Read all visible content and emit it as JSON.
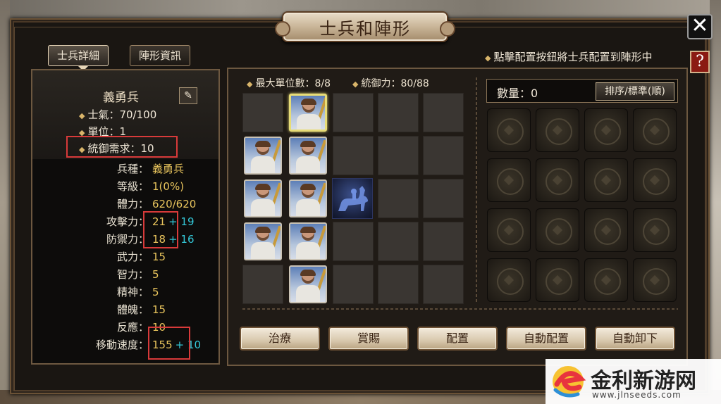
{
  "window": {
    "title": "士兵和陣形",
    "close_label": "✕",
    "help_label": "?"
  },
  "tabs": [
    {
      "label": "士兵詳細",
      "active": true
    },
    {
      "label": "陣形資訊",
      "active": false
    }
  ],
  "instruction": "點擊配置按鈕將士兵配置到陣形中",
  "unit": {
    "name": "義勇兵",
    "morale": "士氣：70/100",
    "units": "單位：1",
    "command_req": "統御需求：10"
  },
  "stats": [
    {
      "label": "兵種：",
      "value": "義勇兵",
      "bonus": ""
    },
    {
      "label": "等級：",
      "value": "1(0%)",
      "bonus": ""
    },
    {
      "label": "體力：",
      "value": "620/620",
      "bonus": ""
    },
    {
      "label": "攻擊力：",
      "value": "21",
      "bonus": "+ 19"
    },
    {
      "label": "防禦力：",
      "value": "18",
      "bonus": "+ 16"
    },
    {
      "label": "武力：",
      "value": "15",
      "bonus": ""
    },
    {
      "label": "智力：",
      "value": "5",
      "bonus": ""
    },
    {
      "label": "精神：",
      "value": "5",
      "bonus": ""
    },
    {
      "label": "體魄：",
      "value": "15",
      "bonus": ""
    },
    {
      "label": "反應：",
      "value": "10",
      "bonus": ""
    },
    {
      "label": "移動速度：",
      "value": "155",
      "bonus": "+ 10"
    }
  ],
  "formation": {
    "max_units": "最大單位數：8/8",
    "command": "統御力：80/88"
  },
  "inventory": {
    "quantity": "數量：0",
    "sort_label": "排序/標準(順)"
  },
  "actions": [
    "治療",
    "賞賜",
    "配置",
    "自動配置",
    "自動卸下"
  ],
  "watermark": {
    "title": "金利新游网",
    "url": "www.jlnseeds.com"
  },
  "colors": {
    "gold": "#e9c55d",
    "bonus": "#33c8d8",
    "highlight": "#d83a3a",
    "frame": "#6d5840"
  },
  "icons": {
    "edit": "pencil-icon",
    "close": "close-icon",
    "help": "help-icon"
  }
}
